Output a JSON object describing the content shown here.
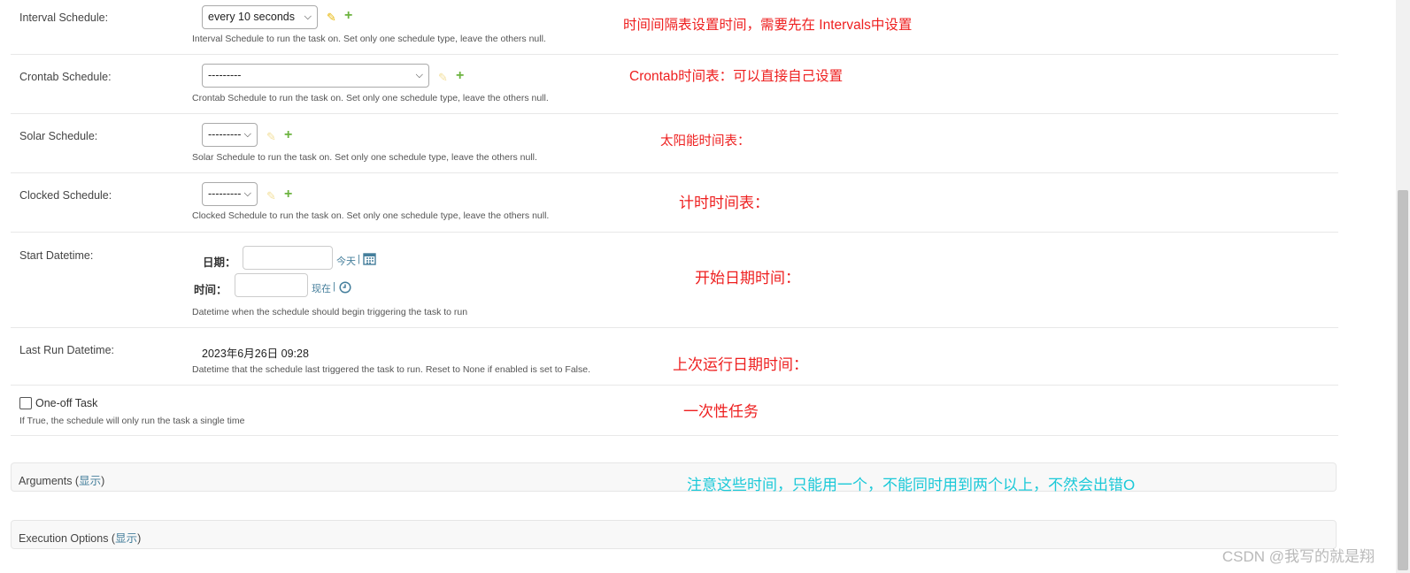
{
  "rows": {
    "interval": {
      "label": "Interval Schedule:",
      "select_value": "every 10 seconds",
      "help": "Interval Schedule to run the task on. Set only one schedule type, leave the others null.",
      "note": "时间间隔表设置时间，需要先在  Intervals中设置"
    },
    "crontab": {
      "label": "Crontab Schedule:",
      "select_value": "---------",
      "help": "Crontab Schedule to run the task on. Set only one schedule type, leave the others null.",
      "note": "Crontab时间表：可以直接自己设置"
    },
    "solar": {
      "label": "Solar Schedule:",
      "select_value": "---------",
      "help": "Solar Schedule to run the task on. Set only one schedule type, leave the others null.",
      "note": "太阳能时间表："
    },
    "clocked": {
      "label": "Clocked Schedule:",
      "select_value": "---------",
      "help": "Clocked Schedule to run the task on. Set only one schedule type, leave the others null.",
      "note": "计时时间表："
    },
    "start": {
      "label": "Start Datetime:",
      "date_label": "日期：",
      "date_value": "",
      "today_link": "今天",
      "separator": "|",
      "time_label": "时间：",
      "time_value": "",
      "now_link": "现在",
      "help": "Datetime when the schedule should begin triggering the task to run",
      "note": "开始日期时间："
    },
    "last_run": {
      "label": "Last Run Datetime:",
      "value": "2023年6月26日 09:28",
      "help": "Datetime that the schedule last triggered the task to run. Reset to None if enabled is set to False.",
      "note": "上次运行日期时间："
    },
    "one_off": {
      "label": "One-off Task",
      "checked": false,
      "help": "If True, the schedule will only run the task a single time",
      "note": "一次性任务"
    }
  },
  "fieldsets": {
    "arguments": {
      "title": "Arguments",
      "toggle": "显示",
      "note": "注意这些时间，只能用一个，不能同时用到两个以上，不然会出错O"
    },
    "execution": {
      "title": "Execution Options",
      "toggle": "显示"
    }
  },
  "watermark": "CSDN @我写的就是翔",
  "icons": {
    "edit": "pencil-icon",
    "add": "plus-icon",
    "calendar": "calendar-icon",
    "clock": "clock-icon",
    "dropdown": "chevron-down-icon"
  },
  "colors": {
    "annotation_red": "#ee1f1f",
    "annotation_cyan": "#1bc9d8",
    "link": "#447e9b",
    "add_green": "#6cb33f",
    "edit_yellow": "#e7b500"
  }
}
